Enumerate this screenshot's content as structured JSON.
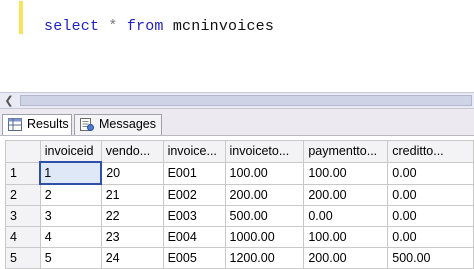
{
  "editor": {
    "query": {
      "kw_select": "select",
      "op_star": "*",
      "kw_from": "from",
      "table": "mcninvoices"
    }
  },
  "results_tabs": [
    {
      "label": "Results",
      "icon": "grid-icon"
    },
    {
      "label": "Messages",
      "icon": "messages-icon"
    }
  ],
  "grid": {
    "columns": [
      "invoiceid",
      "vendo...",
      "invoice...",
      "invoiceto...",
      "paymentto...",
      "creditto..."
    ],
    "rows": [
      {
        "num": "1",
        "cells": [
          "1",
          "20",
          "E001",
          "100.00",
          "100.00",
          "0.00"
        ]
      },
      {
        "num": "2",
        "cells": [
          "2",
          "21",
          "E002",
          "200.00",
          "200.00",
          "0.00"
        ]
      },
      {
        "num": "3",
        "cells": [
          "3",
          "22",
          "E003",
          "500.00",
          "0.00",
          "0.00"
        ]
      },
      {
        "num": "4",
        "cells": [
          "4",
          "23",
          "E004",
          "1000.00",
          "100.00",
          "0.00"
        ]
      },
      {
        "num": "5",
        "cells": [
          "5",
          "24",
          "E005",
          "1200.00",
          "200.00",
          "500.00"
        ]
      }
    ]
  },
  "colors": {
    "keyword": "#1f1fc7",
    "selection_border": "#2f4fa8"
  }
}
